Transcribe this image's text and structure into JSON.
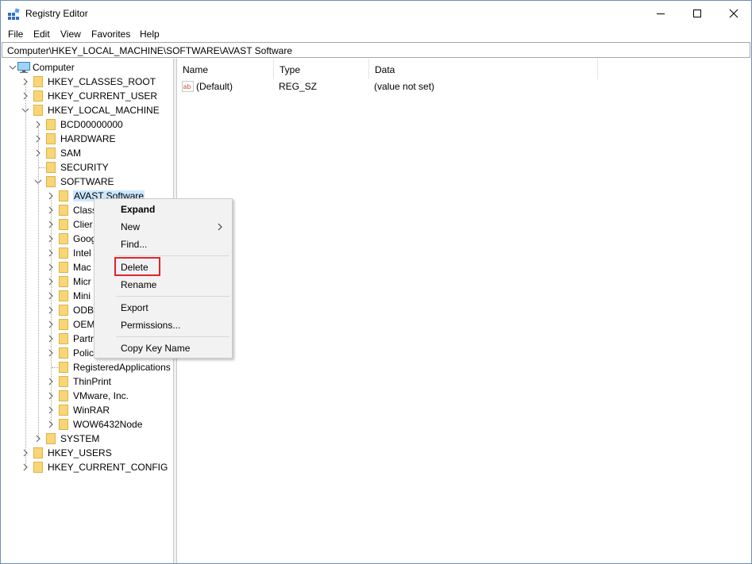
{
  "window": {
    "title": "Registry Editor",
    "controls": [
      "minimize",
      "maximize",
      "close"
    ]
  },
  "menubar": [
    "File",
    "Edit",
    "View",
    "Favorites",
    "Help"
  ],
  "address": "Computer\\HKEY_LOCAL_MACHINE\\SOFTWARE\\AVAST Software",
  "tree": {
    "root": "Computer",
    "hives": [
      "HKEY_CLASSES_ROOT",
      "HKEY_CURRENT_USER",
      "HKEY_LOCAL_MACHINE",
      "HKEY_USERS",
      "HKEY_CURRENT_CONFIG"
    ],
    "hklm_children": [
      "BCD00000000",
      "HARDWARE",
      "SAM",
      "SECURITY",
      "SOFTWARE",
      "SYSTEM"
    ],
    "software_children": [
      "AVAST Software",
      "Class",
      "Clier",
      "Goog",
      "Intel",
      "Mac",
      "Micr",
      "Mini",
      "ODB",
      "OEM",
      "Partr",
      "Polic",
      "RegisteredApplications",
      "ThinPrint",
      "VMware, Inc.",
      "WinRAR",
      "WOW6432Node"
    ]
  },
  "list": {
    "columns": [
      "Name",
      "Type",
      "Data"
    ],
    "rows": [
      {
        "name": "(Default)",
        "type": "REG_SZ",
        "data": "(value not set)"
      }
    ]
  },
  "context_menu": {
    "items": {
      "expand": "Expand",
      "new": "New",
      "find": "Find...",
      "delete": "Delete",
      "rename": "Rename",
      "export": "Export",
      "permissions": "Permissions...",
      "copy_key_name": "Copy Key Name"
    },
    "highlight_color": "#e0252b"
  },
  "colors": {
    "folder": "#f8d675",
    "folder_edge": "#dcb24a",
    "selection": "#cce8ff",
    "window_border": "#6d8fb4"
  }
}
